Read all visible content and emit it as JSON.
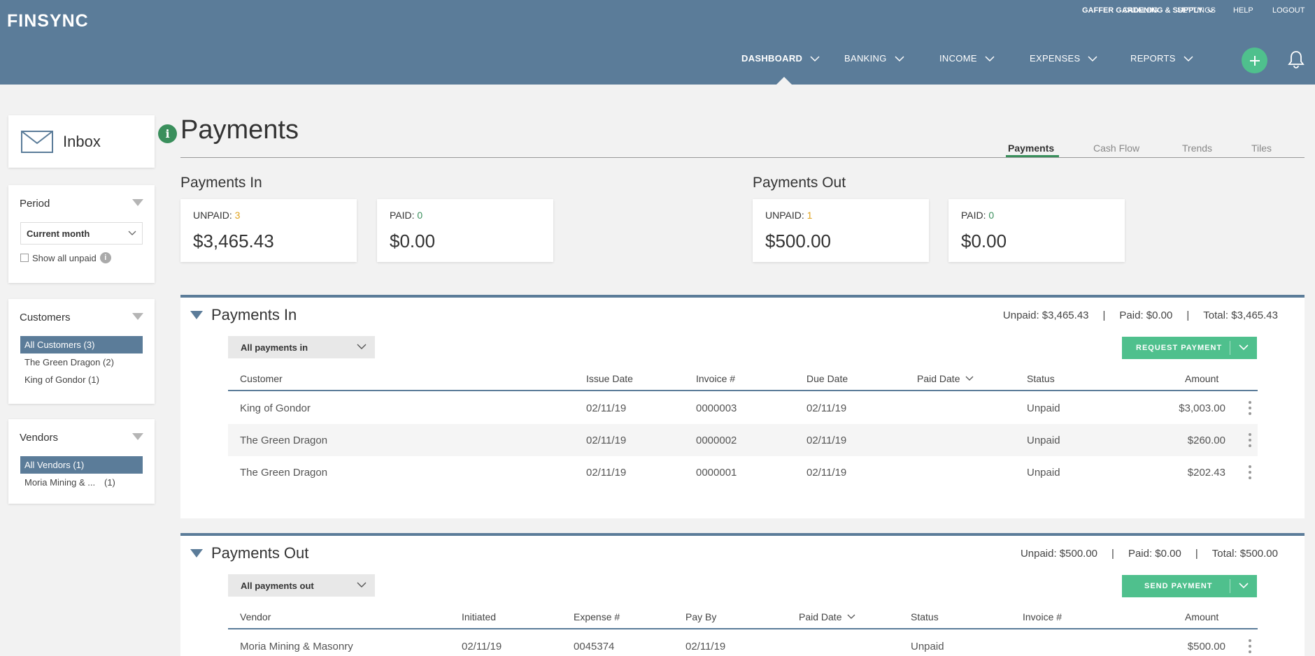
{
  "brand": {
    "logo": "FINSYNC"
  },
  "top_links": {
    "company": "GAFFER GARDENING & SUPPLY",
    "catalog": "CATALOG",
    "settings": "SETTINGS",
    "help": "HELP",
    "logout": "LOGOUT"
  },
  "main_nav": [
    "DASHBOARD",
    "BANKING",
    "INCOME",
    "EXPENSES",
    "REPORTS"
  ],
  "sidebar": {
    "inbox_label": "Inbox",
    "period": {
      "title": "Period",
      "selected": "Current month",
      "show_all_unpaid": "Show all unpaid",
      "info": "i"
    },
    "customers": {
      "title": "Customers",
      "items": [
        {
          "label": "All Customers (3)",
          "count": ""
        },
        {
          "label": "The Green Dragon (2)",
          "count": ""
        },
        {
          "label": "King of Gondor (1)",
          "count": ""
        }
      ]
    },
    "vendors": {
      "title": "Vendors",
      "items": [
        {
          "label": "All Vendors (1)",
          "count": ""
        },
        {
          "label": "Moria Mining & ...",
          "count": "(1)"
        }
      ]
    }
  },
  "page": {
    "info": "i",
    "title": "Payments",
    "tabs": [
      "Payments",
      "Cash Flow",
      "Trends",
      "Tiles"
    ]
  },
  "summary": {
    "in": {
      "label": "Payments In",
      "unpaid_label": "UNPAID: ",
      "unpaid_count": "3",
      "unpaid_amount": "$3,465.43",
      "paid_label": "PAID: ",
      "paid_count": "0",
      "paid_amount": "$0.00"
    },
    "out": {
      "label": "Payments Out",
      "unpaid_label": "UNPAID: ",
      "unpaid_count": "1",
      "unpaid_amount": "$500.00",
      "paid_label": "PAID: ",
      "paid_count": "0",
      "paid_amount": "$0.00"
    }
  },
  "payments_in": {
    "title": "Payments In",
    "totals": {
      "unpaid": "Unpaid: $3,465.43",
      "paid": "Paid: $0.00",
      "total": "Total: $3,465.43",
      "sep": "|"
    },
    "filter": "All payments in",
    "button": "REQUEST PAYMENT",
    "columns": [
      "Customer",
      "Issue Date",
      "Invoice #",
      "Due Date",
      "Paid Date",
      "Status",
      "Amount"
    ],
    "rows": [
      [
        "King of Gondor",
        "02/11/19",
        "0000003",
        "02/11/19",
        "",
        "Unpaid",
        "$3,003.00"
      ],
      [
        "The Green Dragon",
        "02/11/19",
        "0000002",
        "02/11/19",
        "",
        "Unpaid",
        "$260.00"
      ],
      [
        "The Green Dragon",
        "02/11/19",
        "0000001",
        "02/11/19",
        "",
        "Unpaid",
        "$202.43"
      ]
    ]
  },
  "payments_out": {
    "title": "Payments Out",
    "totals": {
      "unpaid": "Unpaid: $500.00",
      "paid": "Paid: $0.00",
      "total": "Total: $500.00",
      "sep": "|"
    },
    "filter": "All payments out",
    "button": "SEND PAYMENT",
    "columns": [
      "Vendor",
      "Initiated",
      "Expense #",
      "Pay By",
      "Paid Date",
      "Status",
      "Invoice #",
      "Amount"
    ],
    "rows": [
      [
        "Moria Mining & Masonry",
        "02/11/19",
        "0045374",
        "02/11/19",
        "",
        "Unpaid",
        "",
        "$500.00"
      ]
    ]
  },
  "colors": {
    "header": "#5b7c99",
    "accent_green": "#4fc08d",
    "info_green": "#3a8f5c",
    "unpaid_orange": "#e0a31f"
  },
  "icons": {
    "add": "plus-icon",
    "notifications": "bell-icon",
    "inbox": "envelope-icon",
    "row_menu": "kebab-icon"
  }
}
